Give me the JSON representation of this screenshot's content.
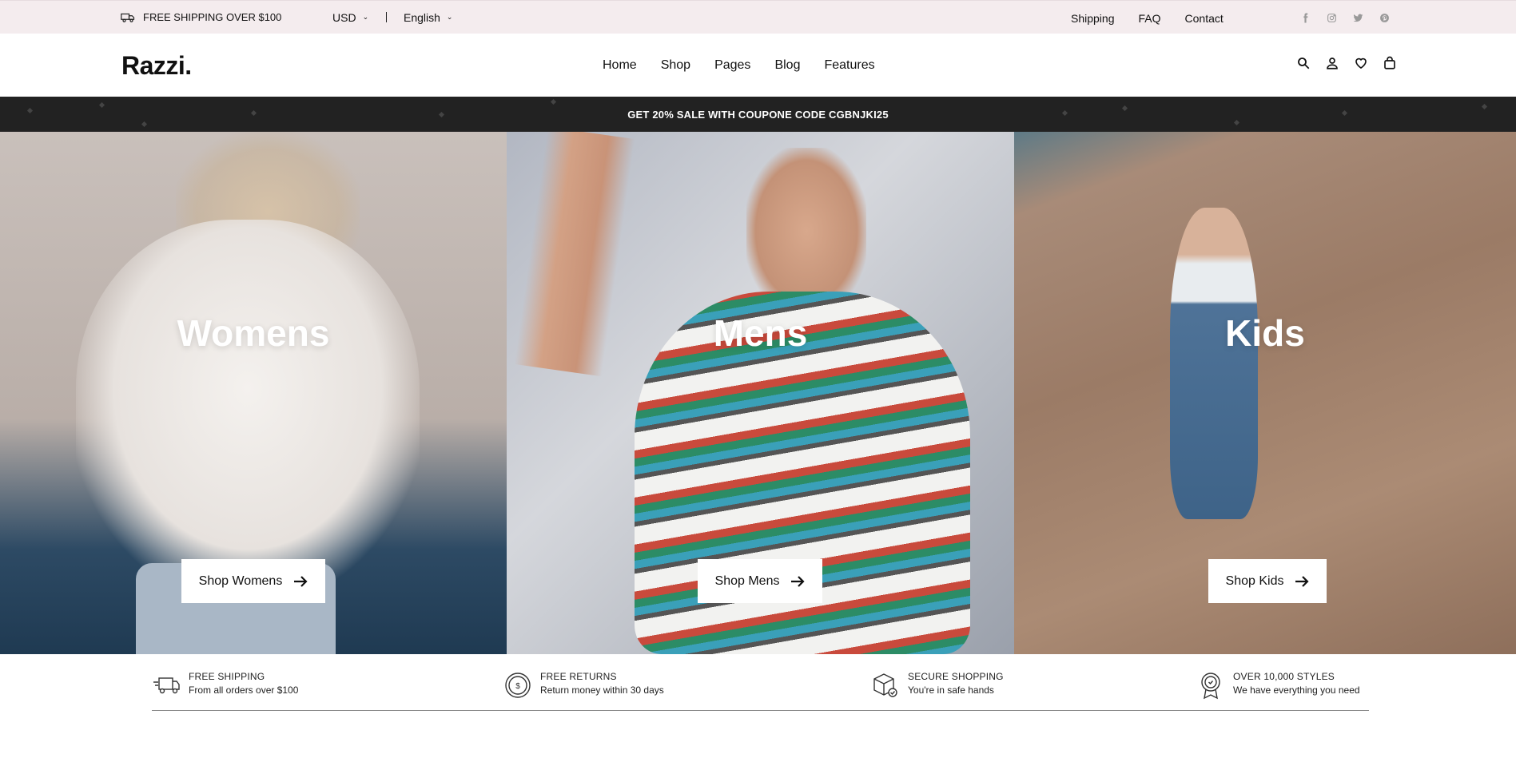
{
  "topbar": {
    "shipping_text": "FREE SHIPPING OVER $100",
    "currency": "USD",
    "language": "English",
    "links": [
      "Shipping",
      "FAQ",
      "Contact"
    ],
    "social_icons": [
      "facebook-icon",
      "instagram-icon",
      "twitter-icon",
      "pinterest-icon"
    ]
  },
  "header": {
    "logo": "Razzi.",
    "nav": [
      "Home",
      "Shop",
      "Pages",
      "Blog",
      "Features"
    ],
    "icons": [
      "search-icon",
      "user-icon",
      "heart-icon",
      "bag-icon"
    ]
  },
  "promo": {
    "text": "GET 20% SALE WITH COUPONE CODE CGBNJKI25"
  },
  "hero": {
    "panels": [
      {
        "title": "Womens",
        "button": "Shop Womens"
      },
      {
        "title": "Mens",
        "button": "Shop Mens"
      },
      {
        "title": "Kids",
        "button": "Shop Kids"
      }
    ]
  },
  "features": [
    {
      "title": "FREE SHIPPING",
      "desc": "From all orders over $100",
      "icon": "truck-icon"
    },
    {
      "title": "FREE RETURNS",
      "desc": "Return money within 30 days",
      "icon": "coin-icon"
    },
    {
      "title": "SECURE SHOPPING",
      "desc": "You're in safe hands",
      "icon": "secure-box-icon"
    },
    {
      "title": "OVER 10,000 STYLES",
      "desc": "We have everything you need",
      "icon": "badge-icon"
    }
  ],
  "colors": {
    "topbar_bg": "#f4ecee",
    "promo_bg": "#222222",
    "text": "#111111"
  }
}
